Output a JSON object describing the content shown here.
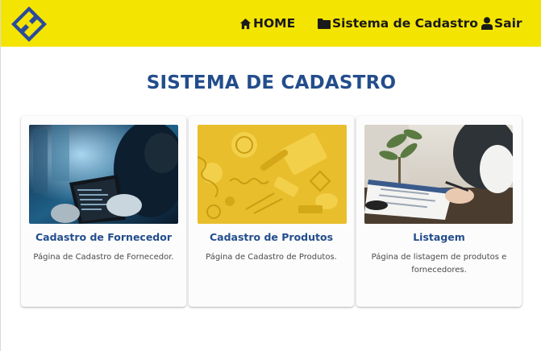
{
  "navbar": {
    "brand_color": "#f4e402",
    "logo_icon": "banco-do-brasil-logo",
    "items": [
      {
        "label": "HOME",
        "icon": "home-icon"
      },
      {
        "label": "Sistema de Cadastro",
        "icon": "folder-icon"
      },
      {
        "label": "Sair",
        "icon": "user-icon"
      }
    ]
  },
  "main": {
    "title": "SISTEMA DE CADASTRO",
    "title_color": "#234d8c",
    "cards": [
      {
        "title": "Cadastro de Fornecedor",
        "text": "Página de Cadastro de Fornecedor.",
        "image": "tech-hands-tablet-photo"
      },
      {
        "title": "Cadastro de Produtos",
        "text": "Página de Cadastro de Produtos.",
        "image": "yellow-objects-photo"
      },
      {
        "title": "Listagem",
        "text": "Página de listagem de produtos e fornecedores.",
        "image": "clipboard-writing-photo"
      }
    ]
  }
}
